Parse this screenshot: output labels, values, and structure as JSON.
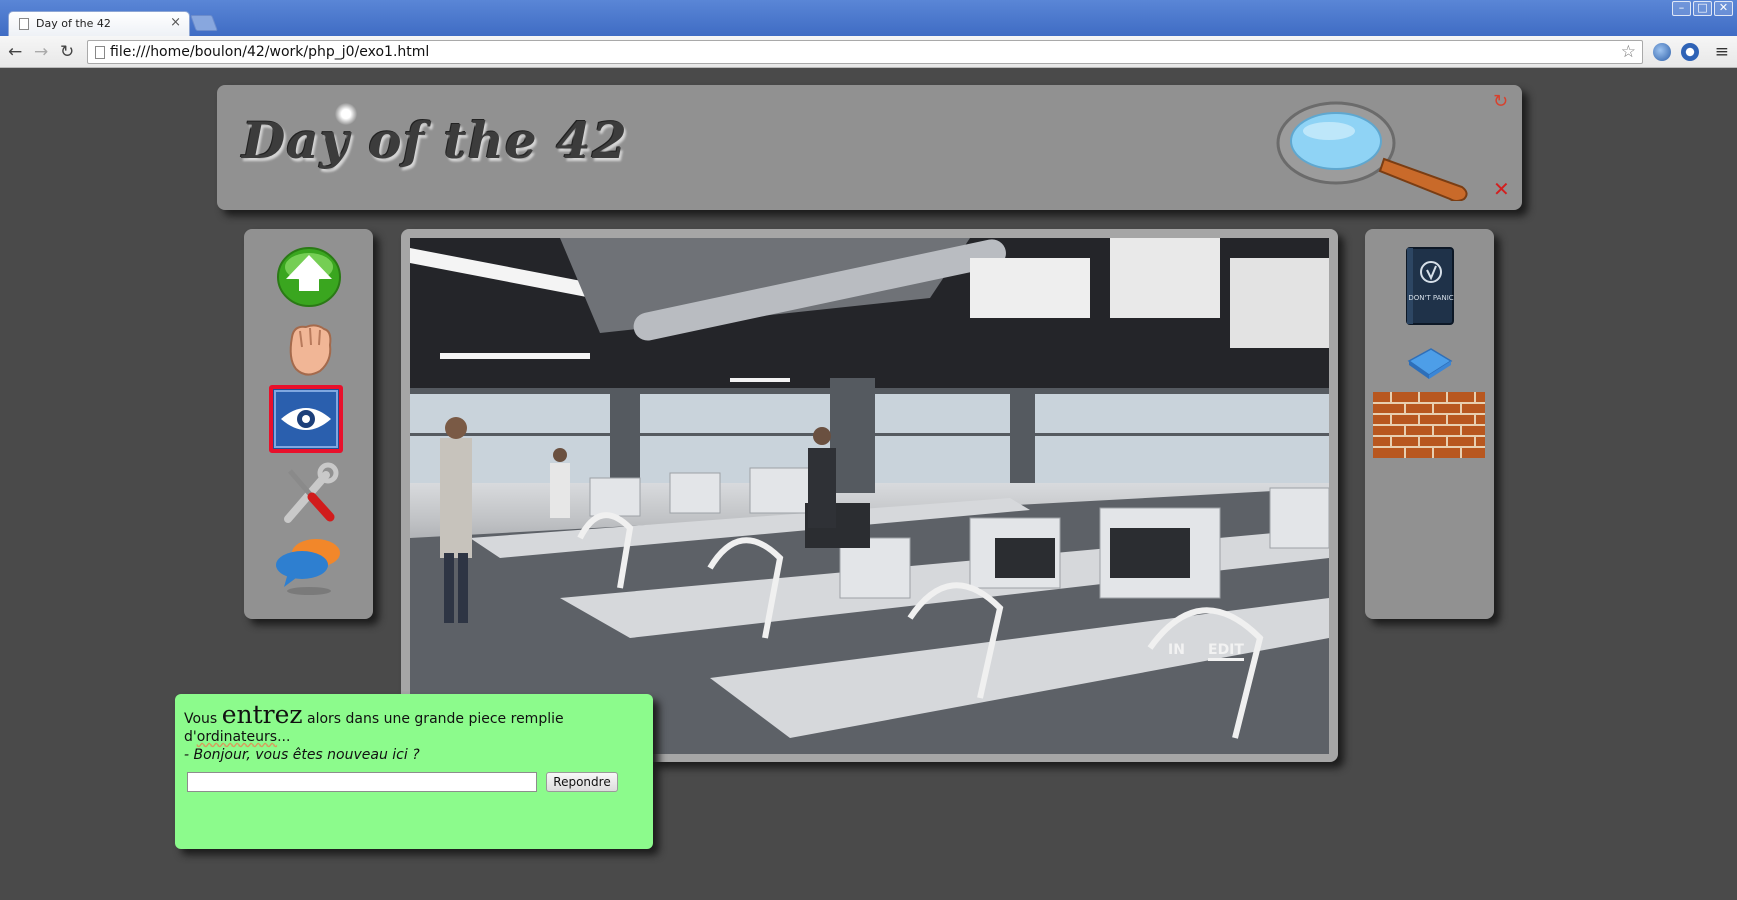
{
  "browser": {
    "tab_title": "Day of the 42",
    "tab_close": "×",
    "url": "file:///home/boulon/42/work/php_j0/exo1.html",
    "window_buttons": [
      "–",
      "□",
      "✕"
    ],
    "back": "←",
    "forward": "→",
    "reload": "↻",
    "bookmark": "☆",
    "menu": "≡"
  },
  "header": {
    "logo_text": "Day of the 42",
    "refresh_icon": "↻",
    "close_icon": "✕"
  },
  "left_menu": {
    "icons": [
      "up-arrow-icon",
      "fist-icon",
      "eye-icon",
      "tools-icon",
      "chat-bubbles-icon"
    ],
    "selected": "eye-icon"
  },
  "right_inventory": {
    "items": [
      "dont-panic-book-icon",
      "towel-icon",
      "brick-wall-icon"
    ],
    "book_text": "DON'T PANIC"
  },
  "scene": {
    "watermark_in": "IN",
    "watermark_edit": "EDIT"
  },
  "dialog": {
    "text_before": "Vous ",
    "big_word": "entrez",
    "text_after": " alors dans une grande piece remplie",
    "line2_prefix": "d'",
    "line2_word": "ordinateurs",
    "line2_suffix": "...",
    "quote": "- Bonjour, vous êtes nouveau ici ?",
    "input_value": "",
    "button_label": "Repondre"
  },
  "colors": {
    "page_bg": "#4a4a4a",
    "panel": "#919191",
    "dialog_bg": "#8cfb8c",
    "selected_border": "#e8102b"
  }
}
